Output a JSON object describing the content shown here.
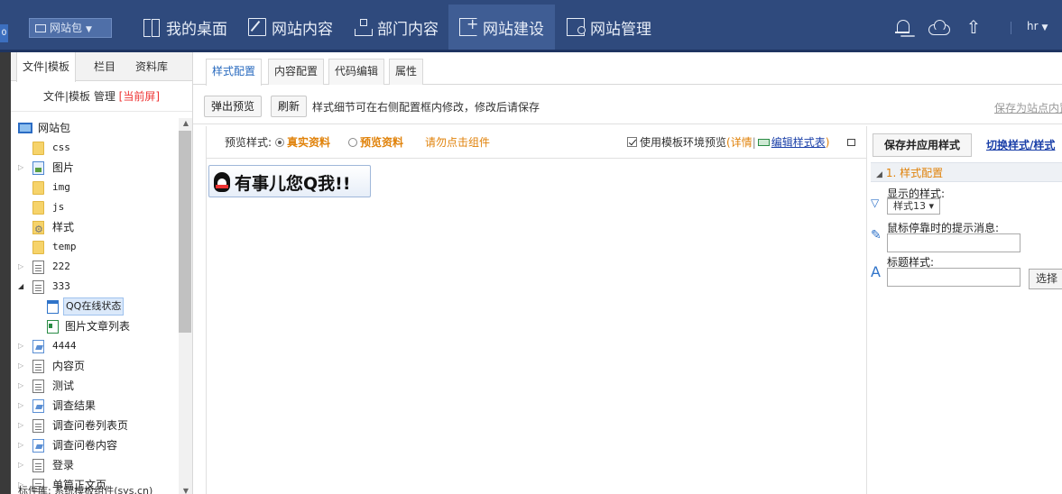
{
  "topbar": {
    "site_selector": "网站包",
    "nav": [
      "我的桌面",
      "网站内容",
      "部门内容",
      "网站建设",
      "网站管理"
    ],
    "active_nav": "网站建设",
    "user": "hr"
  },
  "left_panel": {
    "tabs": [
      "文件|模板",
      "栏目",
      "资料库"
    ],
    "header_main": "文件|模板 管理",
    "header_tag": "[当前屏]",
    "tree": [
      {
        "label": "网站包",
        "icon": "monitor-icon",
        "level": 0
      },
      {
        "label": "css",
        "icon": "folder-icon",
        "level": 1
      },
      {
        "label": "图片",
        "icon": "image-folder-icon",
        "level": 1
      },
      {
        "label": "img",
        "icon": "folder-icon",
        "level": 1
      },
      {
        "label": "js",
        "icon": "folder-icon",
        "level": 1
      },
      {
        "label": "样式",
        "icon": "settings-folder-icon",
        "level": 1
      },
      {
        "label": "temp",
        "icon": "folder-icon",
        "level": 1
      },
      {
        "label": "222",
        "icon": "page-icon",
        "level": 1
      },
      {
        "label": "333",
        "icon": "page-icon",
        "level": 1
      },
      {
        "label": "QQ在线状态",
        "icon": "widget-icon",
        "level": 2
      },
      {
        "label": "图片文章列表",
        "icon": "widget-list-icon",
        "level": 2
      },
      {
        "label": "4444",
        "icon": "edit-page-icon",
        "level": 1
      },
      {
        "label": "内容页",
        "icon": "page-icon",
        "level": 1
      },
      {
        "label": "测试",
        "icon": "page-icon",
        "level": 1
      },
      {
        "label": "调查结果",
        "icon": "edit-page-icon",
        "level": 1
      },
      {
        "label": "调查问卷列表页",
        "icon": "page-icon",
        "level": 1
      },
      {
        "label": "调查问卷内容",
        "icon": "edit-page-icon",
        "level": 1
      },
      {
        "label": "登录",
        "icon": "page-icon",
        "level": 1
      },
      {
        "label": "单篇正文页",
        "icon": "page-icon",
        "level": 1
      }
    ],
    "footer": "标件库: 系统模板组件(sys.cn)"
  },
  "main": {
    "tabs": [
      "样式配置",
      "内容配置",
      "代码编辑",
      "属性"
    ],
    "active_tab": "样式配置",
    "popup_preview": "弹出预览",
    "refresh": "刷新",
    "tip": "样式细节可在右侧配置框内修改，修改后请保存",
    "save_as": "保存为站点内置",
    "preview_label": "预览样式:",
    "option_real": "真实资料",
    "option_preview": "预览资料",
    "hint": "请勿点击组件",
    "use_template_env": "使用模板环境预览",
    "detail": "详情",
    "edit_stylesheet": "编辑样式表",
    "qq_badge_text": "有事儿您Q我!!"
  },
  "config": {
    "save_apply": "保存并应用样式",
    "switch_style": "切换样式/样式",
    "section_title": "1. 样式配置",
    "displayed_style_label": "显示的样式:",
    "displayed_style_value": "样式13",
    "hover_tip_label": "鼠标停靠时的提示消息:",
    "title_style_label": "标题样式:",
    "select_button": "选择"
  }
}
